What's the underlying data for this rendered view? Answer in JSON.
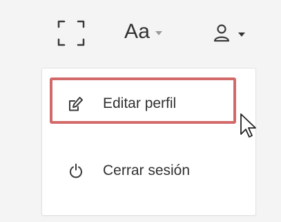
{
  "toolbar": {
    "fullscreen_icon": "fullscreen-icon",
    "font_size_label": "Aa",
    "font_size_caret_icon": "chevron-down-icon",
    "user_icon": "user-icon",
    "user_caret_icon": "chevron-down-icon"
  },
  "user_menu": {
    "items": [
      {
        "label": "Editar perfil",
        "icon": "edit-icon",
        "highlighted": true
      },
      {
        "label": "Cerrar sesión",
        "icon": "power-icon",
        "highlighted": false
      }
    ]
  },
  "colors": {
    "background": "#f4f4f4",
    "menu_background": "#ffffff",
    "highlight_border": "#d26a6a",
    "text": "#2f2f2f",
    "icon": "#3a3a3a",
    "muted_caret": "#9a9a9a"
  }
}
